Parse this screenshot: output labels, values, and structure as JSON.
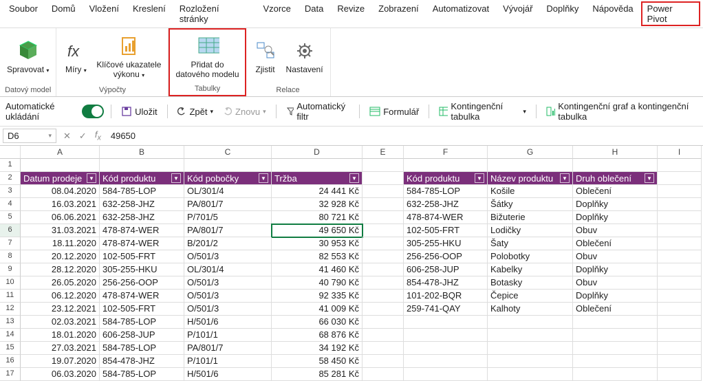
{
  "menu": [
    "Soubor",
    "Domů",
    "Vložení",
    "Kreslení",
    "Rozložení stránky",
    "Vzorce",
    "Data",
    "Revize",
    "Zobrazení",
    "Automatizovat",
    "Vývojář",
    "Doplňky",
    "Nápověda",
    "Power Pivot"
  ],
  "menu_hl": 13,
  "ribbon": {
    "groups": [
      {
        "label": "Datový model",
        "hl": false,
        "buttons": [
          {
            "name": "spravovat",
            "label": "Spravovat",
            "drop": true,
            "icon": "cube"
          }
        ]
      },
      {
        "label": "Výpočty",
        "hl": false,
        "buttons": [
          {
            "name": "miry",
            "label": "Míry",
            "drop": true,
            "icon": "fx"
          },
          {
            "name": "klicove",
            "label": "Klíčové ukazatele\nvýkonu",
            "drop": true,
            "icon": "kpi"
          }
        ]
      },
      {
        "label": "Tabulky",
        "hl": true,
        "buttons": [
          {
            "name": "pridat",
            "label": "Přidat do\ndatového modelu",
            "icon": "table"
          }
        ]
      },
      {
        "label": "Relace",
        "hl": false,
        "buttons": [
          {
            "name": "zjistit",
            "label": "Zjistit",
            "icon": "detect"
          },
          {
            "name": "nastaveni",
            "label": "Nastavení",
            "icon": "gear"
          }
        ]
      }
    ]
  },
  "qat": {
    "autosave": "Automatické ukládání",
    "save": "Uložit",
    "undo": "Zpět",
    "redo": "Znovu",
    "autofilter": "Automatický filtr",
    "form": "Formulář",
    "pivot": "Kontingenční tabulka",
    "pivotchart": "Kontingenční graf a kontingenční tabulka"
  },
  "formula": {
    "cell": "D6",
    "value": "49650"
  },
  "cols": [
    "A",
    "B",
    "C",
    "D",
    "E",
    "F",
    "G",
    "H",
    "I"
  ],
  "selected_row": 6,
  "table1": {
    "headers": [
      "Datum prodeje",
      "Kód produktu",
      "Kód pobočky",
      "Tržba"
    ],
    "rows": [
      [
        "08.04.2020",
        "584-785-LOP",
        "OL/301/4",
        "24 441 Kč"
      ],
      [
        "16.03.2021",
        "632-258-JHZ",
        "PA/801/7",
        "32 928 Kč"
      ],
      [
        "06.06.2021",
        "632-258-JHZ",
        "P/701/5",
        "80 721 Kč"
      ],
      [
        "31.03.2021",
        "478-874-WER",
        "PA/801/7",
        "49 650 Kč"
      ],
      [
        "18.11.2020",
        "478-874-WER",
        "B/201/2",
        "30 953 Kč"
      ],
      [
        "20.12.2020",
        "102-505-FRT",
        "O/501/3",
        "82 553 Kč"
      ],
      [
        "28.12.2020",
        "305-255-HKU",
        "OL/301/4",
        "41 460 Kč"
      ],
      [
        "26.05.2020",
        "256-256-OOP",
        "O/501/3",
        "40 790 Kč"
      ],
      [
        "06.12.2020",
        "478-874-WER",
        "O/501/3",
        "92 335 Kč"
      ],
      [
        "23.12.2021",
        "102-505-FRT",
        "O/501/3",
        "41 009 Kč"
      ],
      [
        "02.03.2021",
        "584-785-LOP",
        "H/501/6",
        "66 030 Kč"
      ],
      [
        "18.01.2020",
        "606-258-JUP",
        "P/101/1",
        "68 876 Kč"
      ],
      [
        "27.03.2021",
        "584-785-LOP",
        "PA/801/7",
        "34 192 Kč"
      ],
      [
        "19.07.2020",
        "854-478-JHZ",
        "P/101/1",
        "58 450 Kč"
      ],
      [
        "06.03.2020",
        "584-785-LOP",
        "H/501/6",
        "85 281 Kč"
      ]
    ]
  },
  "table2": {
    "headers": [
      "Kód produktu",
      "Název produktu",
      "Druh oblečení"
    ],
    "rows": [
      [
        "584-785-LOP",
        "Košile",
        "Oblečení"
      ],
      [
        "632-258-JHZ",
        "Šátky",
        "Doplňky"
      ],
      [
        "478-874-WER",
        "Bižuterie",
        "Doplňky"
      ],
      [
        "102-505-FRT",
        "Lodičky",
        "Obuv"
      ],
      [
        "305-255-HKU",
        "Šaty",
        "Oblečení"
      ],
      [
        "256-256-OOP",
        "Polobotky",
        "Obuv"
      ],
      [
        "606-258-JUP",
        "Kabelky",
        "Doplňky"
      ],
      [
        "854-478-JHZ",
        "Botasky",
        "Obuv"
      ],
      [
        "101-202-BQR",
        "Čepice",
        "Doplňky"
      ],
      [
        "259-741-QAY",
        "Kalhoty",
        "Oblečení"
      ]
    ]
  }
}
